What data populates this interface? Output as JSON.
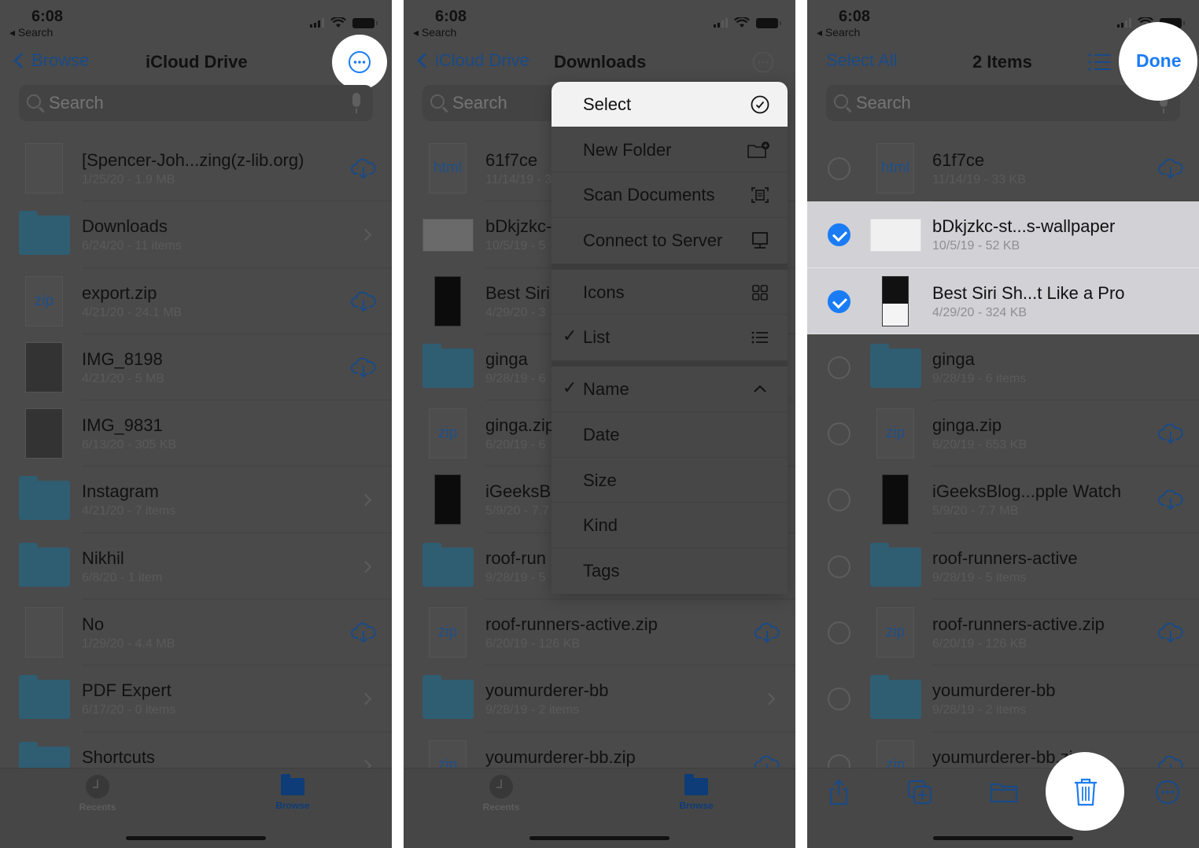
{
  "status": {
    "time": "6:08",
    "back_app": "◂ Search"
  },
  "colors": {
    "accent": "#1a7cf5",
    "dim_accent": "#1a4a86",
    "overlay_bg": "#4a4a4a",
    "selected_row": "#d1d1d6"
  },
  "panel1": {
    "nav": {
      "back_label": "Browse",
      "title": "iCloud Drive",
      "more_icon": "ellipsis-circle-icon"
    },
    "search": {
      "placeholder": "Search"
    },
    "items": [
      {
        "name": "[Spencer-Joh...zing(z-lib.org)",
        "meta": "1/25/20 - 1.9 MB",
        "type": "doc",
        "trail": "cloud"
      },
      {
        "name": "Downloads",
        "meta": "6/24/20 - 11 items",
        "type": "folder",
        "trail": "chevron"
      },
      {
        "name": "export.zip",
        "meta": "4/21/20 - 24.1 MB",
        "type": "zip",
        "thumb_label": "zip",
        "trail": "cloud"
      },
      {
        "name": "IMG_8198",
        "meta": "4/21/20 - 5 MB",
        "type": "image",
        "trail": "cloud"
      },
      {
        "name": "IMG_9831",
        "meta": "6/13/20 - 305 KB",
        "type": "image",
        "trail": "none"
      },
      {
        "name": "Instagram",
        "meta": "4/21/20 - 7 items",
        "type": "folder",
        "trail": "chevron"
      },
      {
        "name": "Nikhil",
        "meta": "6/8/20 - 1 item",
        "type": "folder",
        "trail": "chevron"
      },
      {
        "name": "No",
        "meta": "1/29/20 - 4.4 MB",
        "type": "doc",
        "trail": "cloud"
      },
      {
        "name": "PDF Expert",
        "meta": "6/17/20 - 0 items",
        "type": "folder",
        "trail": "chevron"
      },
      {
        "name": "Shortcuts",
        "meta": "",
        "type": "folder",
        "trail": "chevron"
      }
    ],
    "tabs": [
      {
        "label": "Recents",
        "icon": "clock-icon"
      },
      {
        "label": "Browse",
        "icon": "folder-icon",
        "active": true
      }
    ]
  },
  "panel2": {
    "nav": {
      "back_label": "iCloud Drive",
      "title": "Downloads"
    },
    "search": {
      "placeholder": "Search"
    },
    "items": [
      {
        "name": "61f7ce",
        "meta": "11/14/19 - 3",
        "type": "html",
        "thumb_label": "html"
      },
      {
        "name": "bDkjzkc-",
        "meta": "10/5/19 - 5",
        "type": "wide",
        "thumb_label": ""
      },
      {
        "name": "Best Siri",
        "meta": "4/29/20 - 3",
        "type": "dark"
      },
      {
        "name": "ginga",
        "meta": "9/28/19 - 6",
        "type": "folder"
      },
      {
        "name": "ginga.zip",
        "meta": "6/20/19 - 6",
        "type": "zip",
        "thumb_label": "zip"
      },
      {
        "name": "iGeeksB",
        "meta": "5/9/20 - 7.7",
        "type": "dark"
      },
      {
        "name": "roof-run",
        "meta": "9/28/19 - 5",
        "type": "folder"
      },
      {
        "name": "roof-runners-active.zip",
        "meta": "6/20/19 - 126 KB",
        "type": "zip",
        "thumb_label": "zip",
        "trail": "cloud"
      },
      {
        "name": "youmurderer-bb",
        "meta": "9/28/19 - 2 items",
        "type": "folder",
        "trail": "chevron"
      },
      {
        "name": "youmurderer-bb.zip",
        "meta": "",
        "type": "zip",
        "thumb_label": "zip",
        "trail": "cloud"
      }
    ],
    "menu": {
      "group1": [
        {
          "label": "Select",
          "icon": "checkmark-circle-icon",
          "highlight": true
        },
        {
          "label": "New Folder",
          "icon": "folder-badge-plus-icon"
        },
        {
          "label": "Scan Documents",
          "icon": "doc-viewfinder-icon"
        },
        {
          "label": "Connect to Server",
          "icon": "desktop-computer-icon"
        }
      ],
      "group2": [
        {
          "label": "Icons",
          "icon": "grid-icon"
        },
        {
          "label": "List",
          "icon": "list-bullet-icon",
          "checked": true
        }
      ],
      "group3": [
        {
          "label": "Name",
          "icon": "chevron-up-icon",
          "checked": true
        },
        {
          "label": "Date"
        },
        {
          "label": "Size"
        },
        {
          "label": "Kind"
        },
        {
          "label": "Tags"
        }
      ],
      "check_glyph": "✓"
    },
    "tabs": [
      {
        "label": "Recents",
        "icon": "clock-icon"
      },
      {
        "label": "Browse",
        "icon": "folder-icon",
        "active": true
      }
    ]
  },
  "panel3": {
    "nav": {
      "left_label": "Select All",
      "title": "2 Items",
      "done_label": "Done"
    },
    "search": {
      "placeholder": "Search"
    },
    "items": [
      {
        "name": "61f7ce",
        "meta": "11/14/19 - 33 KB",
        "type": "html",
        "thumb_label": "html",
        "trail": "cloud",
        "selected": false
      },
      {
        "name": "bDkjzkc-st...s-wallpaper",
        "meta": "10/5/19 - 52 KB",
        "type": "wide",
        "thumb_label": "",
        "selected": true
      },
      {
        "name": "Best Siri Sh...t Like a Pro",
        "meta": "4/29/20 - 324 KB",
        "type": "dark",
        "selected": true
      },
      {
        "name": "ginga",
        "meta": "9/28/19 - 6 items",
        "type": "folder",
        "selected": false
      },
      {
        "name": "ginga.zip",
        "meta": "6/20/19 - 653 KB",
        "type": "zip",
        "thumb_label": "zip",
        "trail": "cloud",
        "selected": false
      },
      {
        "name": "iGeeksBlog...pple Watch",
        "meta": "5/9/20 - 7.7 MB",
        "type": "dark",
        "trail": "cloud",
        "selected": false
      },
      {
        "name": "roof-runners-active",
        "meta": "9/28/19 - 5 items",
        "type": "folder",
        "selected": false
      },
      {
        "name": "roof-runners-active.zip",
        "meta": "6/20/19 - 126 KB",
        "type": "zip",
        "thumb_label": "zip",
        "trail": "cloud",
        "selected": false
      },
      {
        "name": "youmurderer-bb",
        "meta": "9/28/19 - 2 items",
        "type": "folder",
        "selected": false
      },
      {
        "name": "youmurderer-bb.zip",
        "meta": "",
        "type": "zip",
        "thumb_label": "zip",
        "trail": "cloud",
        "selected": false
      }
    ],
    "toolbar": [
      {
        "name": "share-button",
        "icon": "share-icon"
      },
      {
        "name": "duplicate-button",
        "icon": "plus-square-on-square-icon"
      },
      {
        "name": "move-button",
        "icon": "folder-icon"
      },
      {
        "name": "delete-button",
        "icon": "trash-icon",
        "highlight": true
      },
      {
        "name": "more-button",
        "icon": "ellipsis-circle-icon"
      }
    ]
  }
}
